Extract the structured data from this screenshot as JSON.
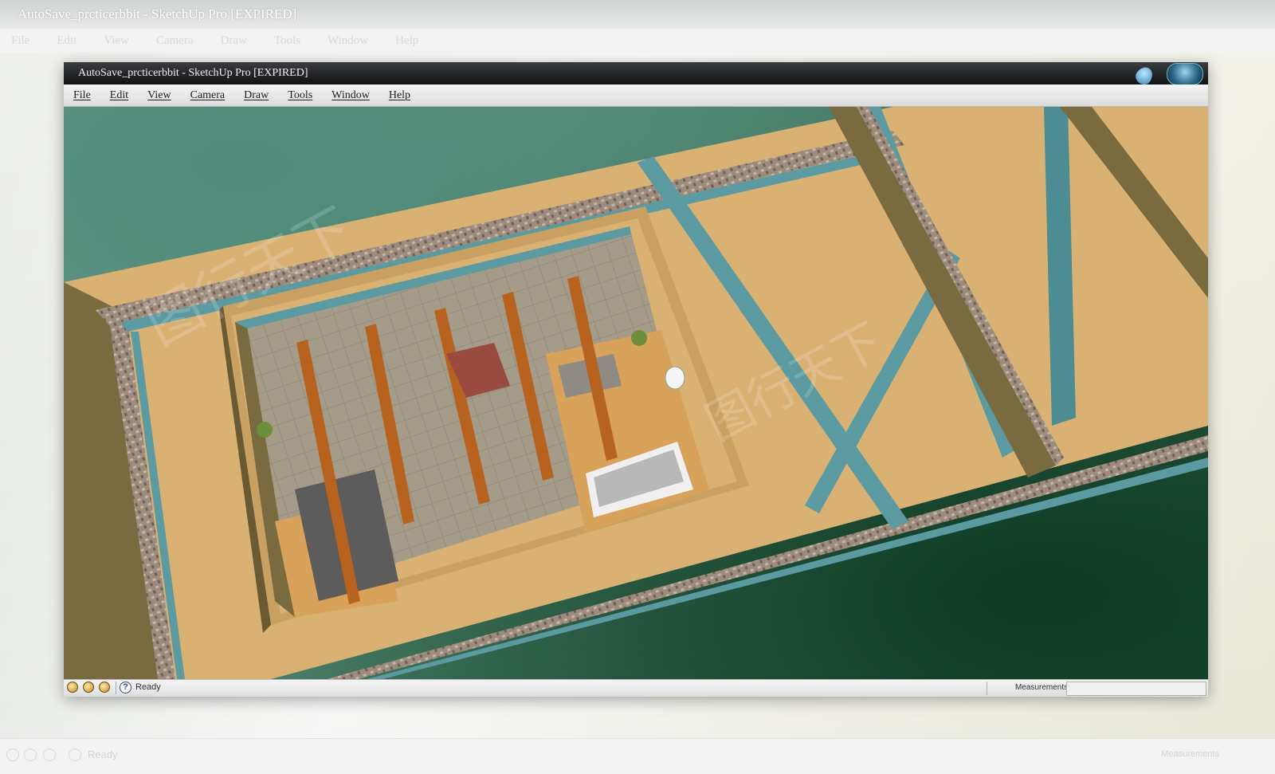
{
  "background_window": {
    "title": "AutoSave_prcticerbbit - SketchUp Pro [EXPIRED]",
    "menu": [
      "File",
      "Edit",
      "View",
      "Camera",
      "Draw",
      "Tools",
      "Window",
      "Help"
    ],
    "status": "Ready",
    "measurements_label": "Measurements"
  },
  "window": {
    "title": "AutoSave_prcticerbbit - SketchUp Pro [EXPIRED]"
  },
  "menu": {
    "items": [
      "File",
      "Edit",
      "View",
      "Camera",
      "Draw",
      "Tools",
      "Window",
      "Help"
    ]
  },
  "statusbar": {
    "status": "Ready",
    "help_glyph": "?",
    "measurements_label": "Measurements",
    "measurements_value": ""
  },
  "icons": {
    "status_icons": [
      "geo-location-icon",
      "credits-icon",
      "user-icon"
    ],
    "help": "help-icon"
  },
  "colors": {
    "sand": "#d9b173",
    "stone_border": "#8c7a6c",
    "water": "#5a9aa0",
    "wall_shadow": "#7a6a40",
    "timber": "#b8621f",
    "floor_tile": "#a59b89",
    "background_green": "#3f735c"
  }
}
